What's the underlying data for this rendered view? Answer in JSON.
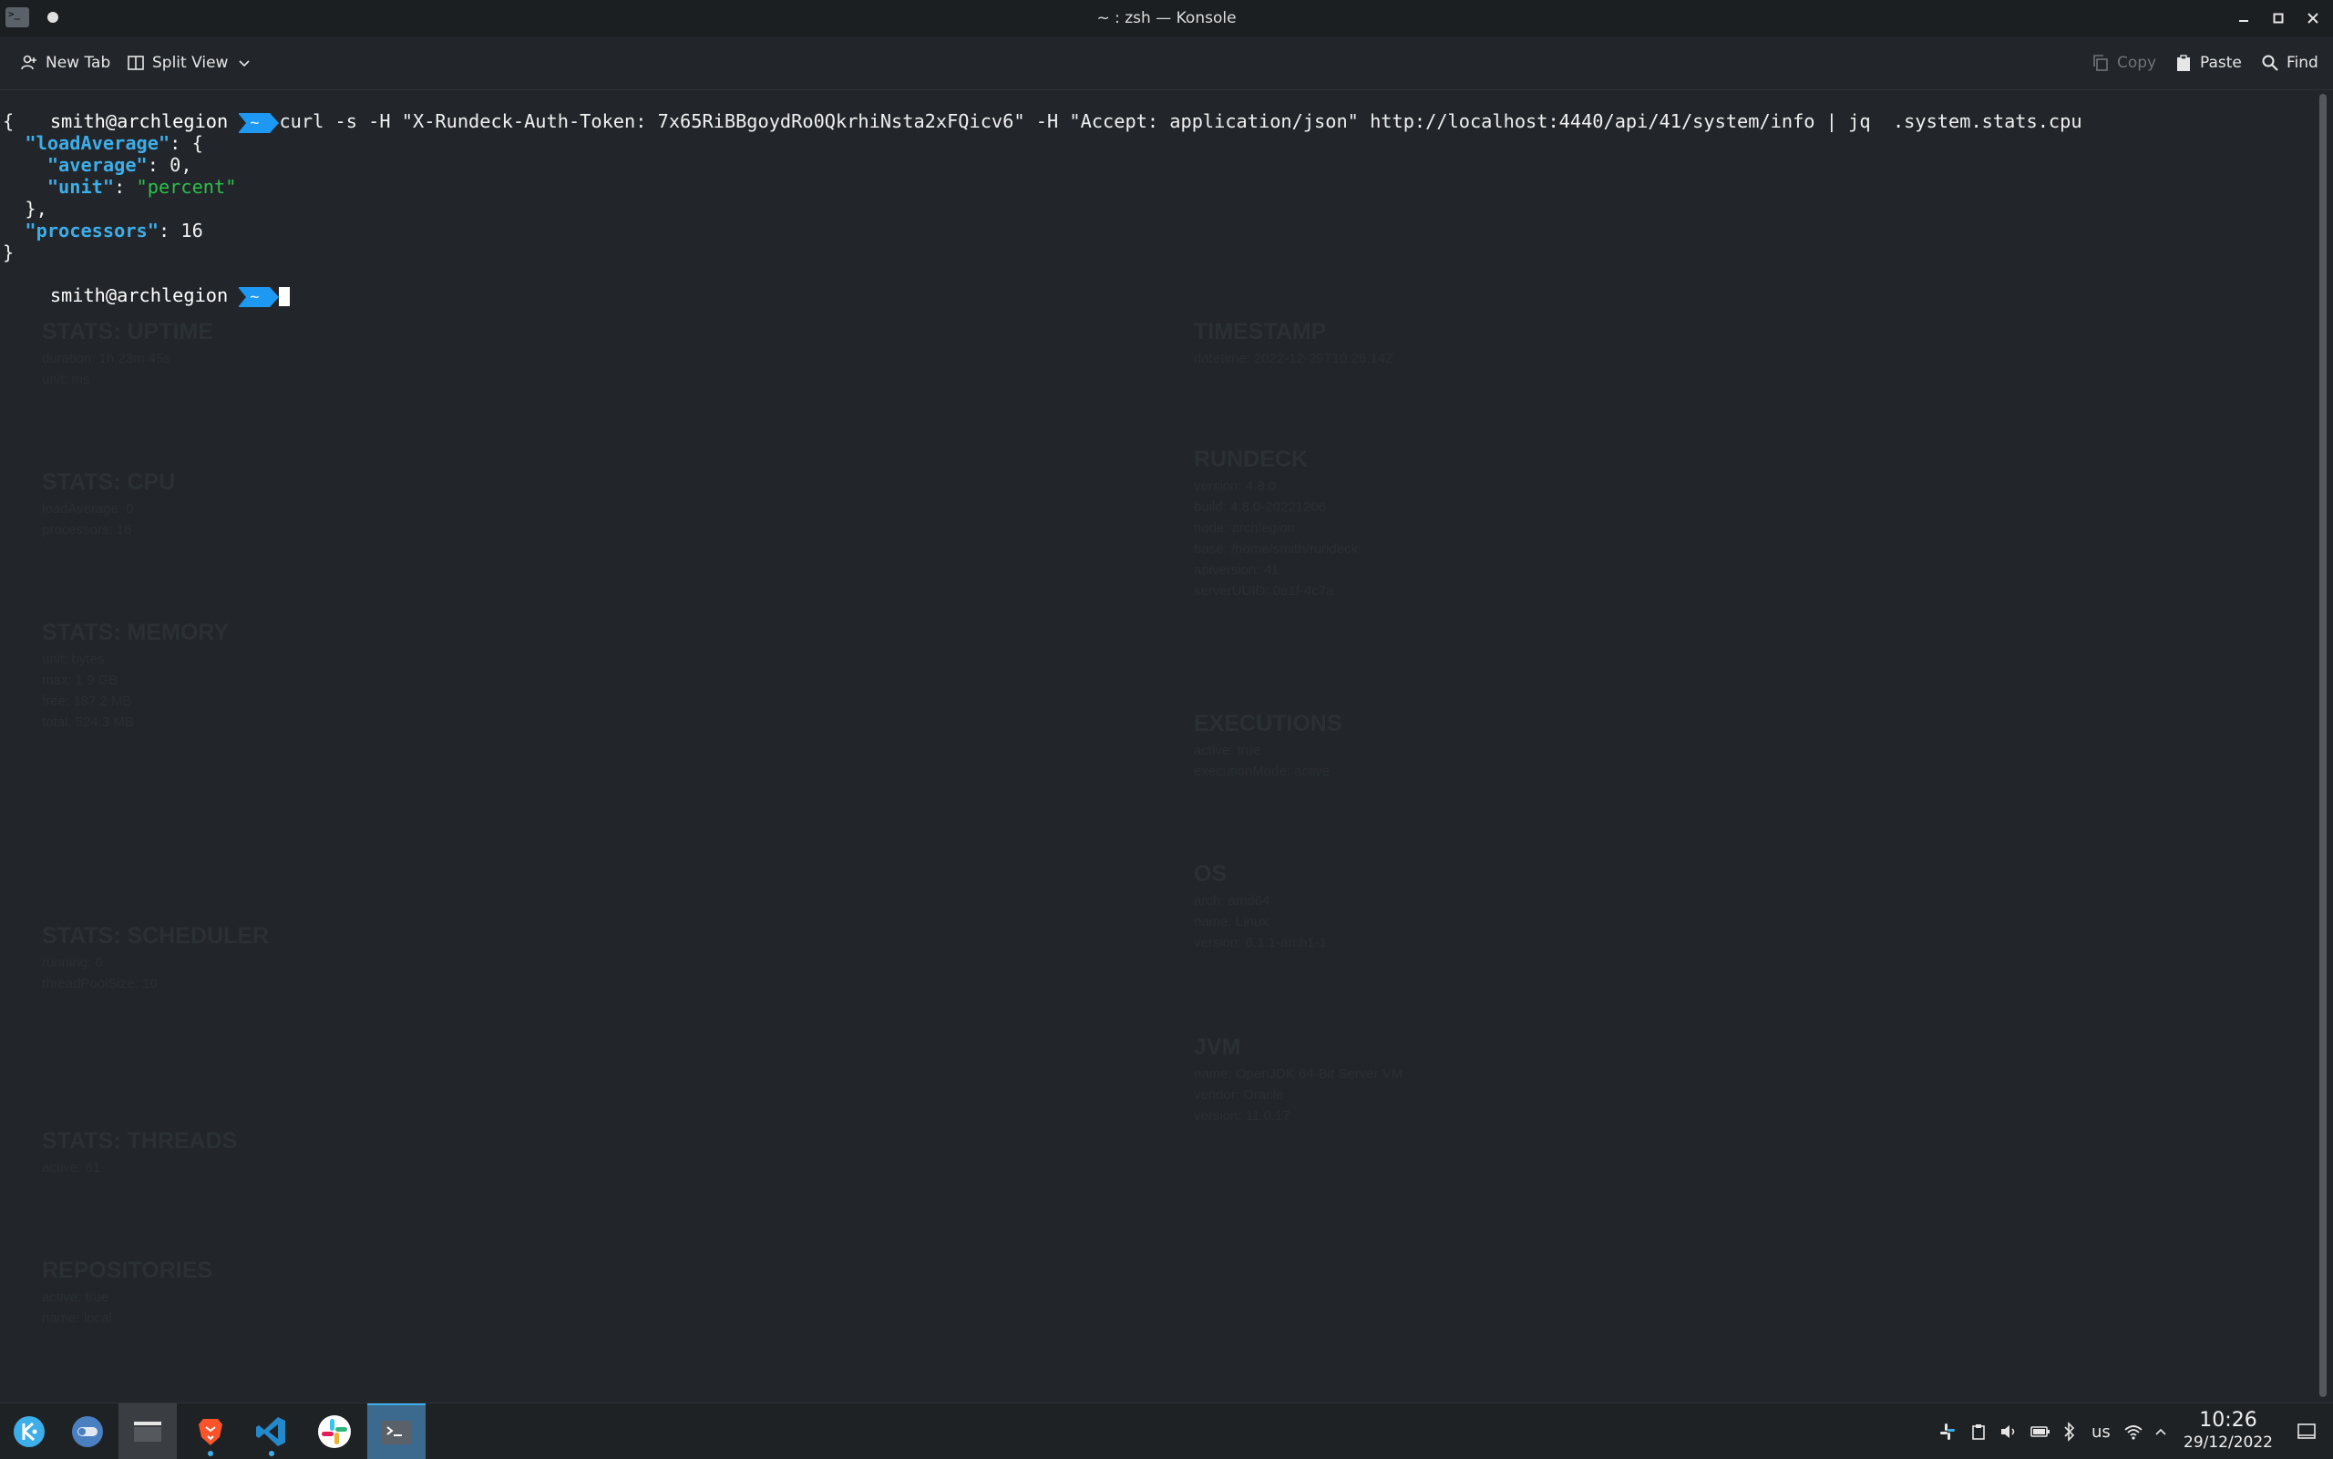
{
  "window": {
    "title": "~ : zsh — Konsole",
    "app_icon_glyph": ">_"
  },
  "toolbar": {
    "new_tab": "New Tab",
    "split_view": "Split View",
    "copy": "Copy",
    "paste": "Paste",
    "find": "Find"
  },
  "terminal": {
    "prompt_user": "smith@archlegion",
    "prompt_dir": "~",
    "command": "curl -s -H \"X-Rundeck-Auth-Token: 7x65RiBBgoydRo0QkrhiNsta2xFQicv6\" -H \"Accept: application/json\" http://localhost:4440/api/41/system/info | jq  .system.stats.cpu",
    "output": {
      "open_brace": "{",
      "loadAverage_key": "\"loadAverage\"",
      "average_key": "\"average\"",
      "average_value": "0",
      "unit_key": "\"unit\"",
      "unit_value": "\"percent\"",
      "close_inner": "},",
      "processors_key": "\"processors\"",
      "processors_value": "16",
      "close_brace": "}"
    }
  },
  "background_ghost": {
    "left": [
      {
        "heading": "STATS: UPTIME",
        "lines": [
          "duration: 1h 23m 45s",
          "unit: ms"
        ]
      },
      {
        "heading": "STATS: CPU",
        "lines": [
          "loadAverage: 0",
          "processors: 16"
        ]
      },
      {
        "heading": "STATS: MEMORY",
        "lines": [
          "unit: bytes",
          "max: 1.9 GB",
          "free: 187.2 MB",
          "total: 524.3 MB"
        ]
      },
      {
        "heading": "STATS: SCHEDULER",
        "lines": [
          "running: 0",
          "threadPoolSize: 10"
        ]
      },
      {
        "heading": "STATS: THREADS",
        "lines": [
          "active: 61"
        ]
      },
      {
        "heading": "REPOSITORIES",
        "lines": [
          "active: true",
          "name: local"
        ]
      }
    ],
    "right": [
      {
        "heading": "TIMESTAMP",
        "lines": [
          "datetime: 2022-12-29T10:26:14Z"
        ]
      },
      {
        "heading": "RUNDECK",
        "lines": [
          "version: 4.8.0",
          "build: 4.8.0-20221206",
          "node: archlegion",
          "base: /home/smith/rundeck",
          "apiversion: 41",
          "serverUUID: 0e1f-4c7a"
        ]
      },
      {
        "heading": "EXECUTIONS",
        "lines": [
          "active: true",
          "executionMode: active"
        ]
      },
      {
        "heading": "OS",
        "lines": [
          "arch: amd64",
          "name: Linux",
          "version: 6.1.1-arch1-1"
        ]
      },
      {
        "heading": "JVM",
        "lines": [
          "name: OpenJDK 64-Bit Server VM",
          "vendor: Oracle",
          "version: 11.0.17"
        ]
      }
    ]
  },
  "taskbar": {
    "apps": [
      {
        "name": "application-launcher"
      },
      {
        "name": "system-settings"
      },
      {
        "name": "file-manager"
      },
      {
        "name": "brave-browser"
      },
      {
        "name": "vscode"
      },
      {
        "name": "slack"
      },
      {
        "name": "konsole"
      }
    ],
    "keyboard_layout": "us",
    "clock_time": "10:26",
    "clock_date": "29/12/2022"
  }
}
